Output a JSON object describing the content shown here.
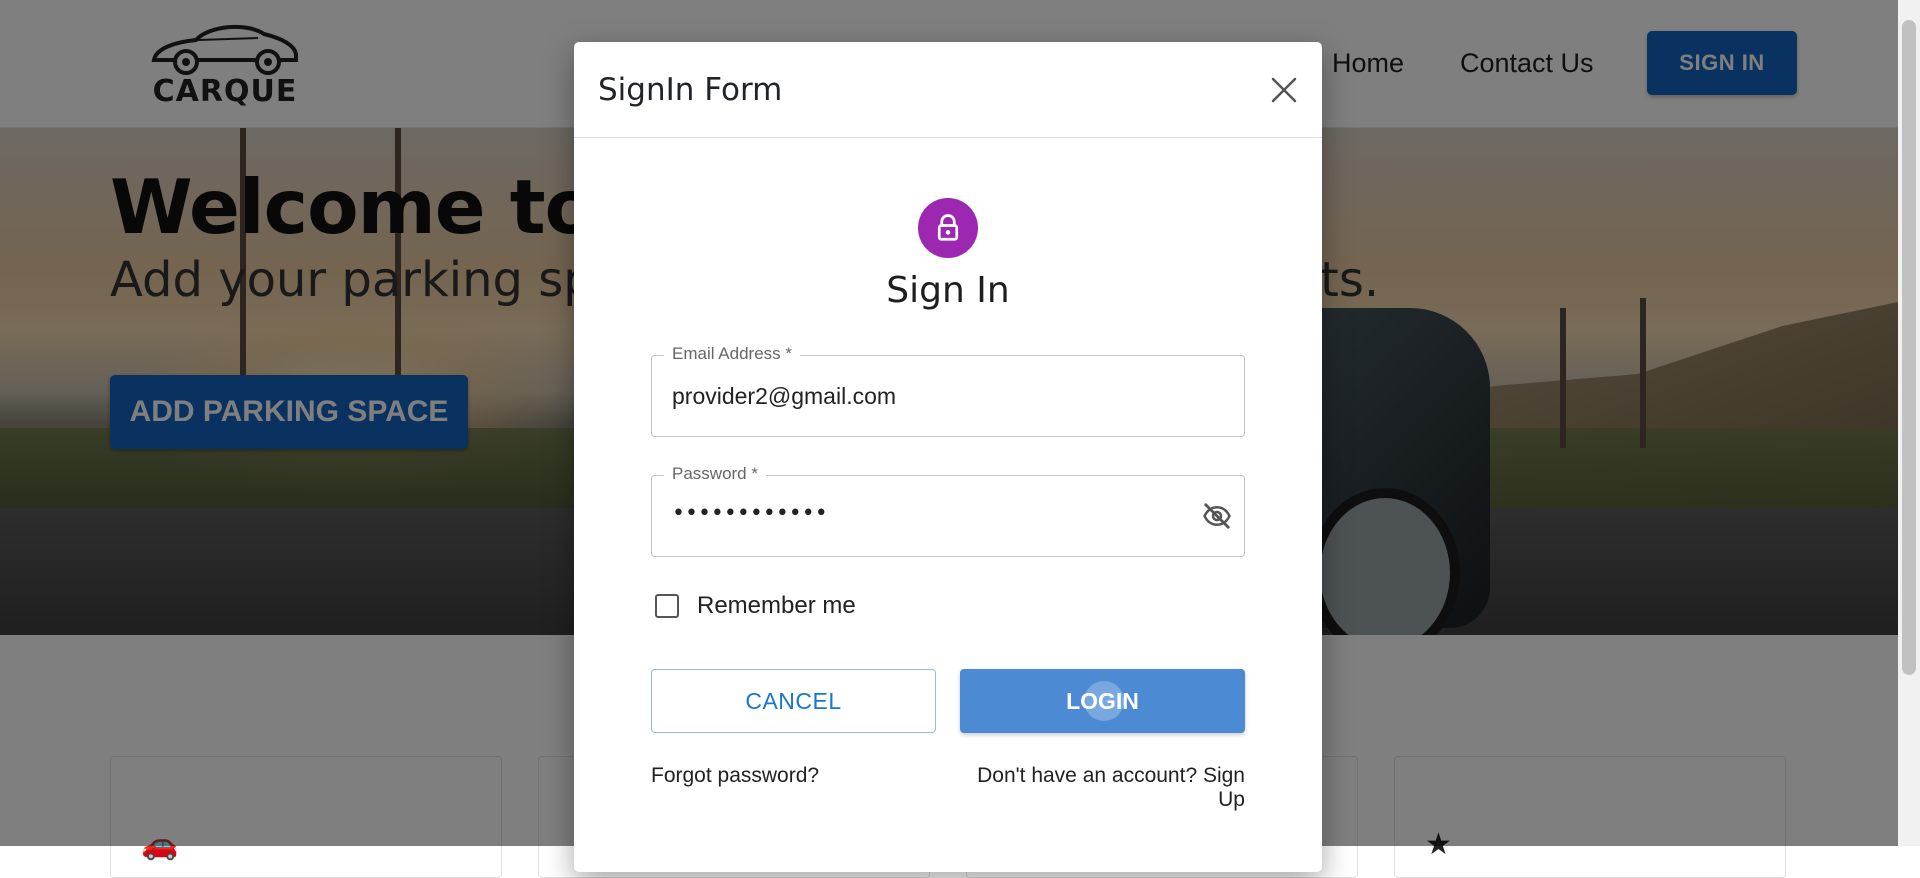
{
  "brand": {
    "logo_text": "CARQUE"
  },
  "nav": {
    "home_label": "Home",
    "contact_label": "Contact Us",
    "signin_label": "SIGN IN"
  },
  "hero": {
    "title": "Welcome to",
    "subtitle": "Add your parking sp",
    "subtitle_end": "ts.",
    "add_button_label": "ADD PARKING SPACE"
  },
  "modal": {
    "title": "SignIn Form",
    "heading": "Sign In",
    "email": {
      "label": "Email Address *",
      "value": "provider2@gmail.com"
    },
    "password": {
      "label": "Password *",
      "masked_value": "••••••••••••"
    },
    "remember_label": "Remember me",
    "remember_checked": false,
    "cancel_label": "CANCEL",
    "login_label": "LOGIN",
    "forgot_label": "Forgot password?",
    "signup_label": "Don't have an account? Sign Up"
  },
  "colors": {
    "primary": "#1565c0",
    "avatar": "#9c27b0",
    "login_button": "#4c8bd3",
    "cancel_text": "#1976d2"
  },
  "icons": {
    "close": "close-icon",
    "lock": "lock-icon",
    "eye": "eye-off-icon",
    "car": "car-icon",
    "star": "star-icon"
  }
}
